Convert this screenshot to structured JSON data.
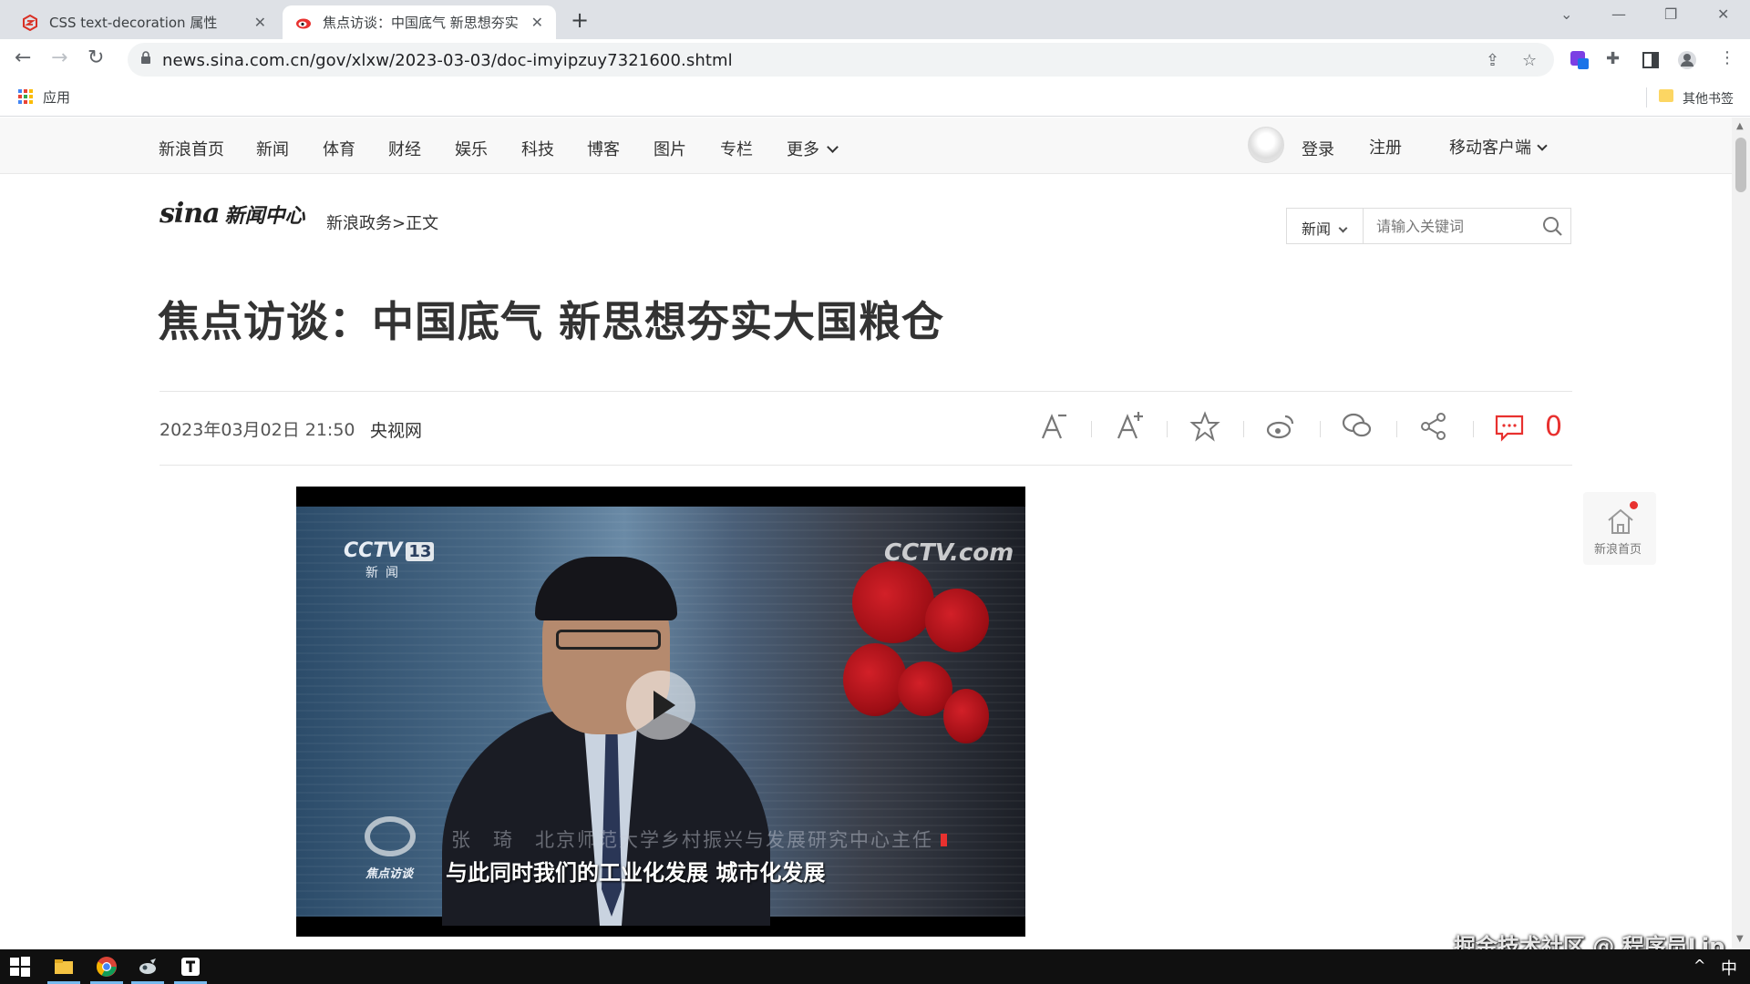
{
  "browser": {
    "tabs": [
      {
        "title": "CSS text-decoration 属性",
        "active": false
      },
      {
        "title": "焦点访谈：中国底气 新思想夯实",
        "active": true
      }
    ],
    "new_tab": "+",
    "url": "news.sina.com.cn/gov/xlxw/2023-03-03/doc-imyipzuy7321600.shtml",
    "bookmarks": {
      "apps_label": "应用",
      "other_label": "其他书签"
    }
  },
  "site_nav": {
    "items": [
      "新浪首页",
      "新闻",
      "体育",
      "财经",
      "娱乐",
      "科技",
      "博客",
      "图片",
      "专栏",
      "更多"
    ],
    "login": "登录",
    "register": "注册",
    "mobile": "移动客户端"
  },
  "header": {
    "logo_text": "sina",
    "logo_suffix": "新闻中心",
    "breadcrumb": "新浪政务>正文",
    "search": {
      "category": "新闻",
      "placeholder": "请输入关键词"
    }
  },
  "article": {
    "title": "焦点访谈：中国底气 新思想夯实大国粮仓",
    "date": "2023年03月02日 21:50",
    "source": "央视网",
    "comment_count": "0"
  },
  "video": {
    "channel_logo": "CCTV",
    "channel_number": "13",
    "channel_sub": "新闻",
    "brand": "CCTV.com",
    "program_label": "焦点访谈",
    "speaker_caption": "张　琦　北京师范大学乡村振兴与发展研究中心主任",
    "subtitle": "与此同时我们的工业化发展  城市化发展"
  },
  "float_home": {
    "label": "新浪首页"
  },
  "watermark": "掘金技术社区 @ 程序员Lip",
  "taskbar": {
    "ime": "中",
    "tray": "^"
  },
  "colors": {
    "sina_red": "#e8312f",
    "chrome_tab_bg": "#dee1e6",
    "omnibox_bg": "#f1f3f4",
    "nav_bg": "#f8f8f8",
    "taskbar_bg": "#101010"
  }
}
